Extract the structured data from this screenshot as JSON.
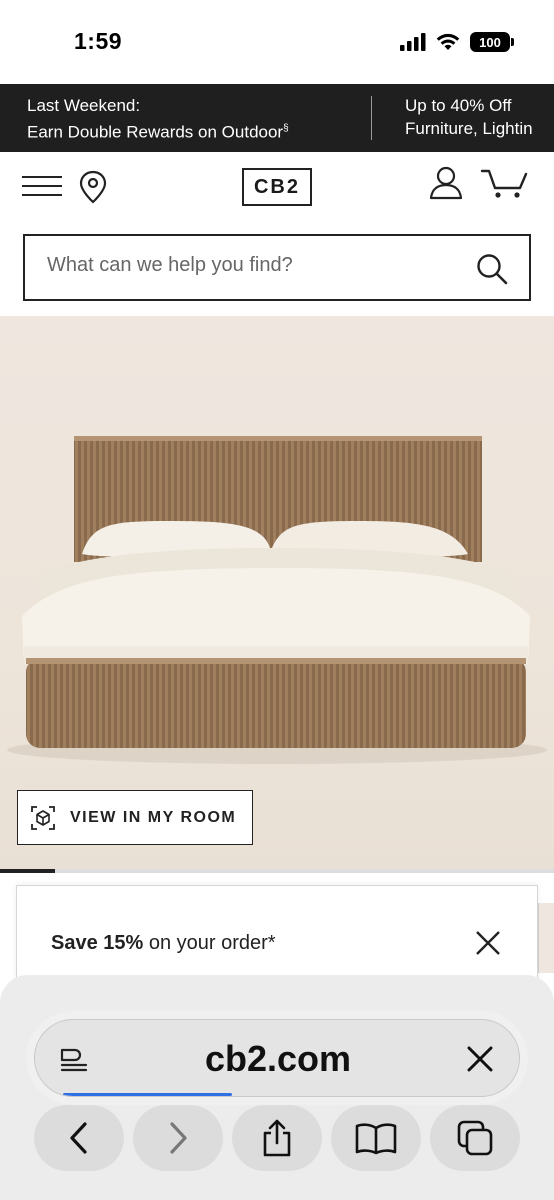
{
  "status_bar": {
    "time": "1:59",
    "battery": "100",
    "icons": [
      "signal-icon",
      "wifi-icon",
      "battery-icon"
    ]
  },
  "promo": {
    "left_line1": "Last Weekend:",
    "left_line2": "Earn Double Rewards on Outdoor",
    "left_mark": "§",
    "right_line1": "Up to 40% Off",
    "right_line2": "Furniture, Lightin"
  },
  "header": {
    "logo": "CB2",
    "icons": [
      "menu-icon",
      "location-pin-icon",
      "account-icon",
      "cart-icon"
    ]
  },
  "search": {
    "placeholder": "What can we help you find?",
    "value": ""
  },
  "hero": {
    "view_in_room_label": "VIEW IN MY ROOM",
    "carousel_progress": 0.1
  },
  "save_panel": {
    "bold_text": "Save 15%",
    "rest_text": " on your order*"
  },
  "browser": {
    "url": "cb2.com",
    "load_progress": 0.35,
    "toolbar": [
      "back-icon",
      "forward-icon",
      "share-icon",
      "bookmarks-icon",
      "tabs-icon"
    ]
  },
  "colors": {
    "banner_bg": "#1f1f1f",
    "hero_bg": "#efe7df",
    "wood": "#9a7a5a",
    "load_bar": "#2f6fe4"
  }
}
